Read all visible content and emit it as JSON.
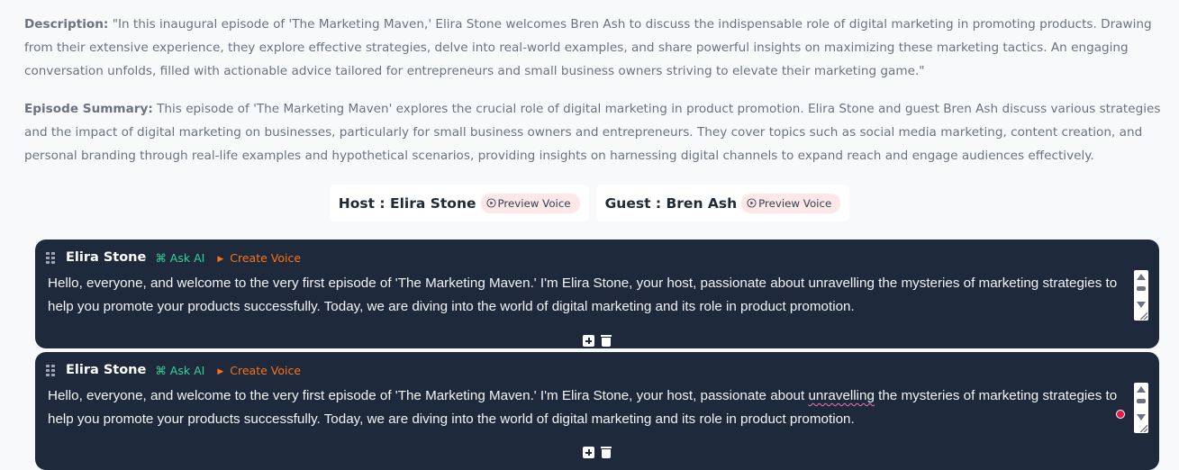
{
  "description": {
    "label": "Description:",
    "text": "\"In this inaugural episode of 'The Marketing Maven,' Elira Stone welcomes Bren Ash to discuss the indispensable role of digital marketing in promoting products. Drawing from their extensive experience, they explore effective strategies, delve into real-world examples, and share powerful insights on maximizing these marketing tactics. An engaging conversation unfolds, filled with actionable advice tailored for entrepreneurs and small business owners striving to elevate their marketing game.\""
  },
  "summary": {
    "label": "Episode Summary:",
    "text": "This episode of 'The Marketing Maven' explores the crucial role of digital marketing in product promotion. Elira Stone and guest Bren Ash discuss various strategies and the impact of digital marketing on businesses, particularly for small business owners and entrepreneurs. They cover topics such as social media marketing, content creation, and personal branding through real-life examples and hypothetical scenarios, providing insights on harnessing digital channels to expand reach and engage audiences effectively."
  },
  "speakers": {
    "host": {
      "label": "Host : Elira Stone",
      "preview_label": "Preview Voice"
    },
    "guest": {
      "label": "Guest : Bren Ash",
      "preview_label": "Preview Voice"
    }
  },
  "blocks": [
    {
      "speaker": "Elira Stone",
      "ask_ai_label": "⌘ Ask AI",
      "create_voice_label": "Create Voice",
      "text_before": "Hello, everyone, and welcome to the very first episode of 'The Marketing Maven.' I'm Elira Stone, your host, passionate about ",
      "text_flagged": "unravelling",
      "text_after": " the mysteries of marketing strategies to help you promote your products successfully. Today, we are diving into the world of digital marketing and its role in product promotion."
    },
    {
      "speaker": "Elira Stone",
      "ask_ai_label": "⌘ Ask AI",
      "create_voice_label": "Create Voice",
      "text_before": "Hello, everyone, and welcome to the very first episode of 'The Marketing Maven.' I'm Elira Stone, your host, passionate about ",
      "text_flagged": "unravelling",
      "text_after": " the mysteries of marketing strategies to help you promote your products successfully. Today, we are diving into the world of digital marketing and its role in product promotion."
    }
  ],
  "colors": {
    "block_background": "#1e293b",
    "ask_ai": "#34d399",
    "create_voice": "#f97316",
    "preview_badge": "#fde8e8",
    "spell_underline": "#f472b6"
  }
}
